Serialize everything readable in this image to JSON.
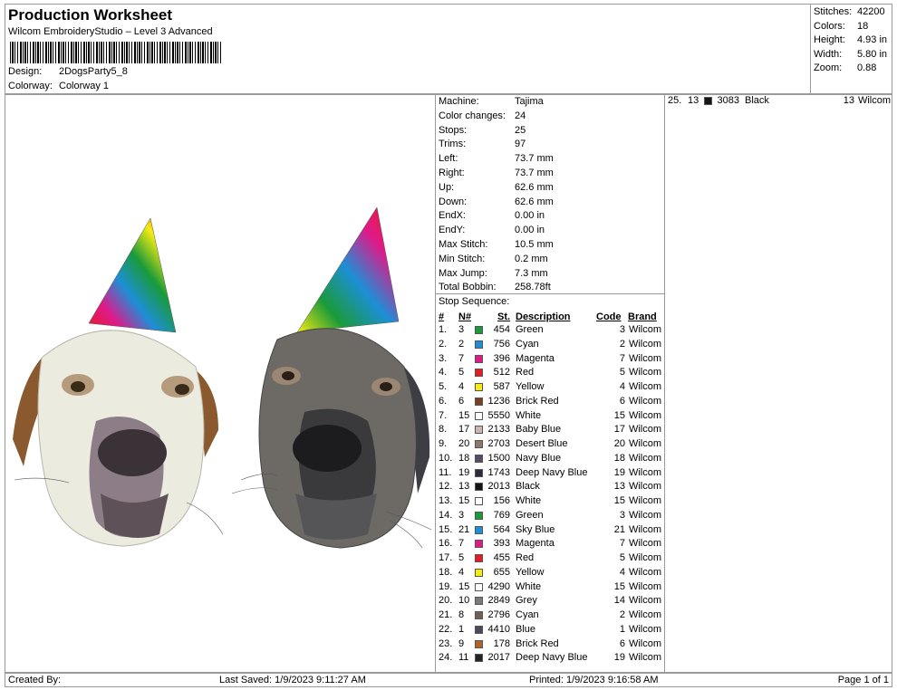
{
  "header": {
    "title": "Production Worksheet",
    "software": "Wilcom EmbroideryStudio – Level 3 Advanced",
    "design_label": "Design:",
    "design_value": "2DogsParty5_8",
    "colorway_label": "Colorway:",
    "colorway_value": "Colorway 1"
  },
  "summary": [
    {
      "label": "Stitches:",
      "value": "42200"
    },
    {
      "label": "Colors:",
      "value": "18"
    },
    {
      "label": "Height:",
      "value": "4.93 in"
    },
    {
      "label": "Width:",
      "value": "5.80 in"
    },
    {
      "label": "Zoom:",
      "value": "0.88"
    }
  ],
  "machine_info": [
    {
      "label": "Machine:",
      "value": "Tajima"
    },
    {
      "label": "Color changes:",
      "value": "24"
    },
    {
      "label": "Stops:",
      "value": "25"
    },
    {
      "label": "Trims:",
      "value": "97"
    },
    {
      "label": "Left:",
      "value": "73.7 mm"
    },
    {
      "label": "Right:",
      "value": "73.7 mm"
    },
    {
      "label": "Up:",
      "value": "62.6 mm"
    },
    {
      "label": "Down:",
      "value": "62.6 mm"
    },
    {
      "label": "EndX:",
      "value": "0.00 in"
    },
    {
      "label": "EndY:",
      "value": "0.00 in"
    },
    {
      "label": "Max Stitch:",
      "value": "10.5 mm"
    },
    {
      "label": "Min Stitch:",
      "value": "0.2 mm"
    },
    {
      "label": "Max Jump:",
      "value": "7.3 mm"
    },
    {
      "label": "Total Bobbin:",
      "value": "258.78ft"
    }
  ],
  "stop_sequence": {
    "title": "Stop Sequence:",
    "headers": {
      "num": "#",
      "n": "N#",
      "st": "St.",
      "desc": "Description",
      "code": "Code",
      "brand": "Brand"
    },
    "rows": [
      {
        "idx": "1.",
        "n": "3",
        "st": "454",
        "desc": "Green",
        "code": "3",
        "brand": "Wilcom",
        "color": "#1a9a3a"
      },
      {
        "idx": "2.",
        "n": "2",
        "st": "756",
        "desc": "Cyan",
        "code": "2",
        "brand": "Wilcom",
        "color": "#1d8fd6"
      },
      {
        "idx": "3.",
        "n": "7",
        "st": "396",
        "desc": "Magenta",
        "code": "7",
        "brand": "Wilcom",
        "color": "#e0198a"
      },
      {
        "idx": "4.",
        "n": "5",
        "st": "512",
        "desc": "Red",
        "code": "5",
        "brand": "Wilcom",
        "color": "#e51c23"
      },
      {
        "idx": "5.",
        "n": "4",
        "st": "587",
        "desc": "Yellow",
        "code": "4",
        "brand": "Wilcom",
        "color": "#f7ec10"
      },
      {
        "idx": "6.",
        "n": "6",
        "st": "1236",
        "desc": "Brick Red",
        "code": "6",
        "brand": "Wilcom",
        "color": "#7a3f22"
      },
      {
        "idx": "7.",
        "n": "15",
        "st": "5550",
        "desc": "White",
        "code": "15",
        "brand": "Wilcom",
        "color": "#ffffff"
      },
      {
        "idx": "8.",
        "n": "17",
        "st": "2133",
        "desc": "Baby Blue",
        "code": "17",
        "brand": "Wilcom",
        "color": "#cbb7ae"
      },
      {
        "idx": "9.",
        "n": "20",
        "st": "2703",
        "desc": "Desert Blue",
        "code": "20",
        "brand": "Wilcom",
        "color": "#8a7966"
      },
      {
        "idx": "10.",
        "n": "18",
        "st": "1500",
        "desc": "Navy Blue",
        "code": "18",
        "brand": "Wilcom",
        "color": "#5a4a6a"
      },
      {
        "idx": "11.",
        "n": "19",
        "st": "1743",
        "desc": "Deep Navy Blue",
        "code": "19",
        "brand": "Wilcom",
        "color": "#2a2a3a"
      },
      {
        "idx": "12.",
        "n": "13",
        "st": "2013",
        "desc": "Black",
        "code": "13",
        "brand": "Wilcom",
        "color": "#151515"
      },
      {
        "idx": "13.",
        "n": "15",
        "st": "156",
        "desc": "White",
        "code": "15",
        "brand": "Wilcom",
        "color": "#ffffff"
      },
      {
        "idx": "14.",
        "n": "3",
        "st": "769",
        "desc": "Green",
        "code": "3",
        "brand": "Wilcom",
        "color": "#1a9a3a"
      },
      {
        "idx": "15.",
        "n": "21",
        "st": "564",
        "desc": "Sky Blue",
        "code": "21",
        "brand": "Wilcom",
        "color": "#1d8fd6"
      },
      {
        "idx": "16.",
        "n": "7",
        "st": "393",
        "desc": "Magenta",
        "code": "7",
        "brand": "Wilcom",
        "color": "#e0198a"
      },
      {
        "idx": "17.",
        "n": "5",
        "st": "455",
        "desc": "Red",
        "code": "5",
        "brand": "Wilcom",
        "color": "#e51c23"
      },
      {
        "idx": "18.",
        "n": "4",
        "st": "655",
        "desc": "Yellow",
        "code": "4",
        "brand": "Wilcom",
        "color": "#f7ec10"
      },
      {
        "idx": "19.",
        "n": "15",
        "st": "4290",
        "desc": "White",
        "code": "15",
        "brand": "Wilcom",
        "color": "#ffffff"
      },
      {
        "idx": "20.",
        "n": "10",
        "st": "2849",
        "desc": "Grey",
        "code": "14",
        "brand": "Wilcom",
        "color": "#7a7a7a"
      },
      {
        "idx": "21.",
        "n": "8",
        "st": "2796",
        "desc": "Cyan",
        "code": "2",
        "brand": "Wilcom",
        "color": "#6d6258"
      },
      {
        "idx": "22.",
        "n": "1",
        "st": "4410",
        "desc": "Blue",
        "code": "1",
        "brand": "Wilcom",
        "color": "#4a4a5a"
      },
      {
        "idx": "23.",
        "n": "9",
        "st": "178",
        "desc": "Brick Red",
        "code": "6",
        "brand": "Wilcom",
        "color": "#b0642c"
      },
      {
        "idx": "24.",
        "n": "11",
        "st": "2017",
        "desc": "Deep Navy Blue",
        "code": "19",
        "brand": "Wilcom",
        "color": "#222228"
      }
    ]
  },
  "stop_sequence_cont": [
    {
      "idx": "25.",
      "n": "13",
      "st": "3083",
      "desc": "Black",
      "code": "13",
      "brand": "Wilcom",
      "color": "#151515"
    }
  ],
  "footer": {
    "created_by": "Created By:",
    "last_saved": "Last Saved: 1/9/2023 9:11:27 AM",
    "printed": "Printed: 1/9/2023 9:16:58 AM",
    "page": "Page 1 of 1"
  }
}
